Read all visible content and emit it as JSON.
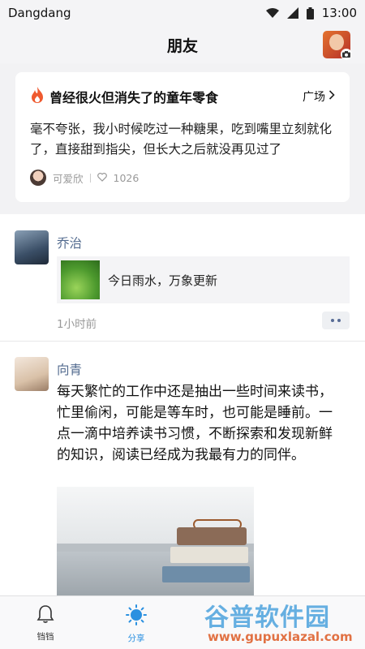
{
  "status_bar": {
    "carrier": "Dangdang",
    "time": "13:00"
  },
  "header": {
    "title": "朋友"
  },
  "featured": {
    "title": "曾经很火但消失了的童年零食",
    "link_label": "广场",
    "body": "毫不夸张，我小时候吃过一种糖果，吃到嘴里立刻就化了，直接甜到指尖，但长大之后就没再见过了",
    "author": "可爱欣",
    "likes": "1026"
  },
  "posts": [
    {
      "author": "乔治",
      "share_text": "今日雨水，万象更新",
      "time": "1小时前"
    },
    {
      "author": "向青",
      "text": "每天繁忙的工作中还是抽出一些时间来读书，忙里偷闲，可能是等车时，也可能是睡前。一点一滴中培养读书习惯，不断探索和发现新鲜的知识，阅读已经成为我最有力的同伴。"
    }
  ],
  "tabs": [
    {
      "label": "铛铛",
      "icon": "bell-icon",
      "active": false
    },
    {
      "label": "分享",
      "icon": "sun-icon",
      "active": true
    }
  ],
  "watermark": {
    "main": "谷普软件园",
    "sub": "www.gupuxlazal.com"
  },
  "colors": {
    "accent": "#2a90e0",
    "author_link": "#536b8f",
    "fire": "#ef5a2f"
  }
}
